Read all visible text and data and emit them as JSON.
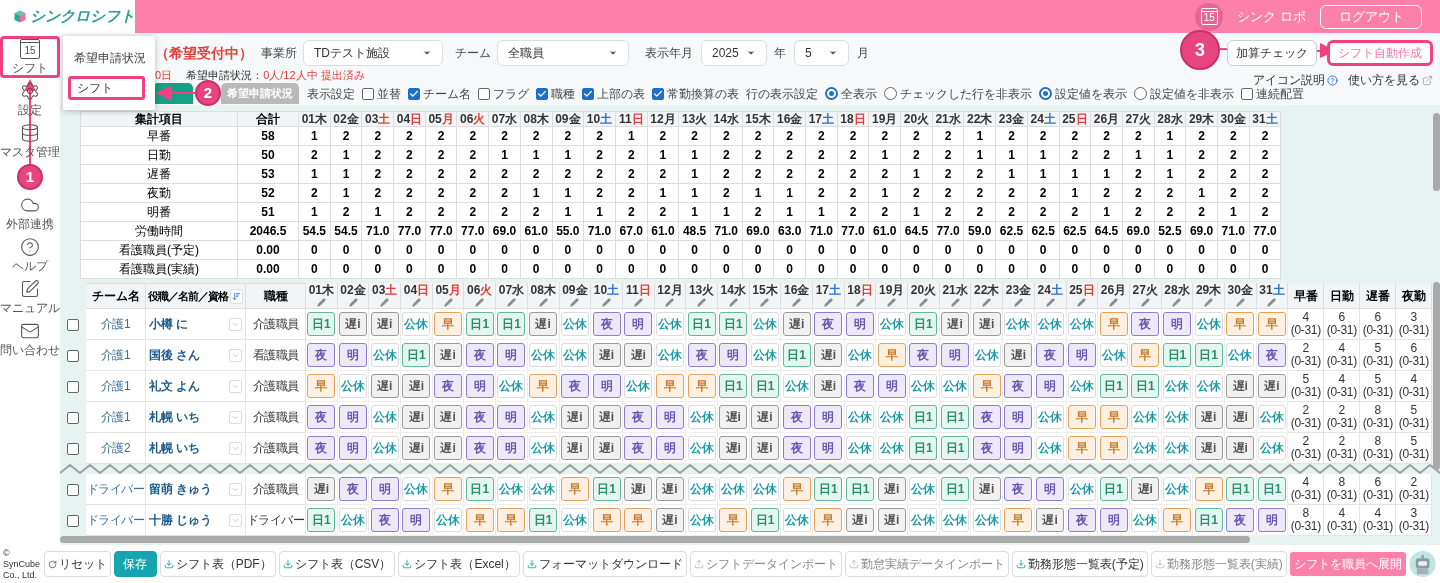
{
  "header": {
    "logo": "シンクロシフト",
    "calendar_date": "15",
    "robot_link": "シンク ロボ",
    "logout": "ログアウト"
  },
  "sidebar": {
    "items": [
      {
        "label": "シフト",
        "date": "15",
        "kind": "shift",
        "highlighted": true
      },
      {
        "label": "設定",
        "kind": "settings",
        "highlighted": false
      },
      {
        "label": "マスタ管理",
        "kind": "master",
        "highlighted": false
      },
      {
        "label": "外部連携",
        "kind": "integration",
        "highlighted": false
      },
      {
        "label": "ヘルプ",
        "kind": "help",
        "highlighted": false
      },
      {
        "label": "マニュアル",
        "kind": "manual",
        "highlighted": false
      },
      {
        "label": "問い合わせ",
        "kind": "contact",
        "highlighted": false
      }
    ]
  },
  "popup_menu": {
    "items": [
      {
        "label": "希望申請状況",
        "highlighted": false
      },
      {
        "label": "シフト",
        "highlighted": true
      }
    ]
  },
  "annotations": [
    {
      "label": "1"
    },
    {
      "label": "2"
    },
    {
      "label": "3"
    }
  ],
  "status": {
    "title": "（希望受付中）",
    "deadline": "0日",
    "request_label": "希望申請状況：",
    "request_value": "0人/12人中 提出済み"
  },
  "tabs": [
    {
      "selected": true
    },
    {
      "label": "希望申請状況",
      "selected": false
    }
  ],
  "filters": {
    "office_label": "事業所",
    "office": "TDテスト施設",
    "team_label": "チーム",
    "team": "全職員",
    "period_label": "表示年月",
    "year": "2025",
    "year_unit": "年",
    "month": "5",
    "month_unit": "月"
  },
  "actions": [
    {
      "label": "加算チェック",
      "highlighted": false
    },
    {
      "label": "シフト自動作成",
      "highlighted": true
    }
  ],
  "display_settings": {
    "label": "表示設定",
    "checkboxes": [
      {
        "label": "並替",
        "checked": false
      },
      {
        "label": "チーム名",
        "checked": true
      },
      {
        "label": "フラグ",
        "checked": false
      },
      {
        "label": "職種",
        "checked": true
      },
      {
        "label": "上部の表",
        "checked": true
      },
      {
        "label": "常勤換算の表",
        "checked": true
      }
    ],
    "row_label": "行の表示設定",
    "row_radios": [
      {
        "label": "全表示",
        "selected": true
      },
      {
        "label": "チェックした行を非表示",
        "selected": false
      }
    ],
    "value_radios": [
      {
        "label": "設定値を表示",
        "selected": true
      },
      {
        "label": "設定値を非表示",
        "selected": false
      }
    ],
    "continuous": {
      "label": "連続配置",
      "checked": false
    }
  },
  "links": [
    {
      "label": "アイコン説明",
      "kind": "help"
    },
    {
      "label": "使い方を見る",
      "kind": "external"
    }
  ],
  "summary": {
    "header": "集計項目",
    "total_header": "合計",
    "days": [
      {
        "date": "01",
        "weekday": "木",
        "kind": "weekday"
      },
      {
        "date": "02",
        "weekday": "金",
        "kind": "weekday"
      },
      {
        "date": "03",
        "weekday": "土",
        "kind": "holiday"
      },
      {
        "date": "04",
        "weekday": "日",
        "kind": "holiday"
      },
      {
        "date": "05",
        "weekday": "月",
        "kind": "holiday"
      },
      {
        "date": "06",
        "weekday": "火",
        "kind": "holiday"
      },
      {
        "date": "07",
        "weekday": "水",
        "kind": "weekday"
      },
      {
        "date": "08",
        "weekday": "木",
        "kind": "weekday"
      },
      {
        "date": "09",
        "weekday": "金",
        "kind": "weekday"
      },
      {
        "date": "10",
        "weekday": "土",
        "kind": "saturday"
      },
      {
        "date": "11",
        "weekday": "日",
        "kind": "holiday"
      },
      {
        "date": "12",
        "weekday": "月",
        "kind": "weekday"
      },
      {
        "date": "13",
        "weekday": "火",
        "kind": "weekday"
      },
      {
        "date": "14",
        "weekday": "水",
        "kind": "weekday"
      },
      {
        "date": "15",
        "weekday": "木",
        "kind": "weekday"
      },
      {
        "date": "16",
        "weekday": "金",
        "kind": "weekday"
      },
      {
        "date": "17",
        "weekday": "土",
        "kind": "saturday"
      },
      {
        "date": "18",
        "weekday": "日",
        "kind": "holiday"
      },
      {
        "date": "19",
        "weekday": "月",
        "kind": "weekday"
      },
      {
        "date": "20",
        "weekday": "火",
        "kind": "weekday"
      },
      {
        "date": "21",
        "weekday": "水",
        "kind": "weekday"
      },
      {
        "date": "22",
        "weekday": "木",
        "kind": "weekday"
      },
      {
        "date": "23",
        "weekday": "金",
        "kind": "weekday"
      },
      {
        "date": "24",
        "weekday": "土",
        "kind": "saturday"
      },
      {
        "date": "25",
        "weekday": "日",
        "kind": "holiday"
      },
      {
        "date": "26",
        "weekday": "月",
        "kind": "weekday"
      },
      {
        "date": "27",
        "weekday": "火",
        "kind": "weekday"
      },
      {
        "date": "28",
        "weekday": "水",
        "kind": "weekday"
      },
      {
        "date": "29",
        "weekday": "木",
        "kind": "weekday"
      },
      {
        "date": "30",
        "weekday": "金",
        "kind": "weekday"
      },
      {
        "date": "31",
        "weekday": "土",
        "kind": "saturday"
      }
    ],
    "rows": [
      {
        "label": "早番",
        "total": "58",
        "values": [
          "1",
          "2",
          "2",
          "2",
          "2",
          "2",
          "2",
          "2",
          "2",
          "2",
          "1",
          "2",
          "2",
          "2",
          "2",
          "2",
          "2",
          "2",
          "2",
          "2",
          "2",
          "1",
          "2",
          "2",
          "2",
          "2",
          "2",
          "1",
          "2",
          "2",
          "2"
        ]
      },
      {
        "label": "日勤",
        "total": "50",
        "values": [
          "2",
          "1",
          "2",
          "2",
          "2",
          "2",
          "1",
          "1",
          "1",
          "2",
          "2",
          "1",
          "1",
          "2",
          "2",
          "2",
          "2",
          "2",
          "1",
          "2",
          "2",
          "1",
          "1",
          "1",
          "2",
          "2",
          "1",
          "1",
          "2",
          "2",
          "2"
        ]
      },
      {
        "label": "遅番",
        "total": "53",
        "values": [
          "1",
          "1",
          "2",
          "2",
          "2",
          "2",
          "2",
          "2",
          "2",
          "2",
          "2",
          "2",
          "1",
          "2",
          "2",
          "2",
          "2",
          "2",
          "2",
          "1",
          "2",
          "2",
          "1",
          "1",
          "1",
          "1",
          "2",
          "1",
          "2",
          "2",
          "2"
        ]
      },
      {
        "label": "夜勤",
        "total": "52",
        "values": [
          "2",
          "1",
          "2",
          "2",
          "2",
          "2",
          "2",
          "1",
          "1",
          "2",
          "2",
          "1",
          "1",
          "2",
          "1",
          "1",
          "2",
          "2",
          "1",
          "2",
          "2",
          "2",
          "2",
          "2",
          "1",
          "2",
          "2",
          "2",
          "1",
          "2",
          "2"
        ]
      },
      {
        "label": "明番",
        "total": "51",
        "values": [
          "1",
          "2",
          "1",
          "2",
          "2",
          "2",
          "2",
          "2",
          "1",
          "1",
          "2",
          "2",
          "1",
          "1",
          "2",
          "1",
          "1",
          "2",
          "2",
          "1",
          "2",
          "2",
          "2",
          "2",
          "2",
          "1",
          "2",
          "2",
          "2",
          "1",
          "2"
        ]
      },
      {
        "label": "労働時間",
        "total": "2046.5",
        "values": [
          "54.5",
          "54.5",
          "71.0",
          "77.0",
          "77.0",
          "77.0",
          "69.0",
          "61.0",
          "55.0",
          "71.0",
          "67.0",
          "61.0",
          "48.5",
          "71.0",
          "69.0",
          "63.0",
          "71.0",
          "77.0",
          "61.0",
          "64.5",
          "77.0",
          "59.0",
          "62.5",
          "62.5",
          "62.5",
          "64.5",
          "69.0",
          "52.5",
          "69.0",
          "71.0",
          "77.0"
        ]
      },
      {
        "label": "看護職員(予定)",
        "total": "0.00",
        "values": [
          "0",
          "0",
          "0",
          "0",
          "0",
          "0",
          "0",
          "0",
          "0",
          "0",
          "0",
          "0",
          "0",
          "0",
          "0",
          "0",
          "0",
          "0",
          "0",
          "0",
          "0",
          "0",
          "0",
          "0",
          "0",
          "0",
          "0",
          "0",
          "0",
          "0",
          "0"
        ]
      },
      {
        "label": "看護職員(実績)",
        "total": "0.00",
        "values": [
          "0",
          "0",
          "0",
          "0",
          "0",
          "0",
          "0",
          "0",
          "0",
          "0",
          "0",
          "0",
          "0",
          "0",
          "0",
          "0",
          "0",
          "0",
          "0",
          "0",
          "0",
          "0",
          "0",
          "0",
          "0",
          "0",
          "0",
          "0",
          "0",
          "0",
          "0"
        ]
      }
    ]
  },
  "shift_table": {
    "columns": {
      "team": "チーム名",
      "name": "役職／名前／資格",
      "job": "職種"
    },
    "days": [
      {
        "date": "01",
        "weekday": "木",
        "kind": "weekday"
      },
      {
        "date": "02",
        "weekday": "金",
        "kind": "weekday"
      },
      {
        "date": "03",
        "weekday": "土",
        "kind": "holiday"
      },
      {
        "date": "04",
        "weekday": "日",
        "kind": "holiday"
      },
      {
        "date": "05",
        "weekday": "月",
        "kind": "holiday"
      },
      {
        "date": "06",
        "weekday": "火",
        "kind": "holiday"
      },
      {
        "date": "07",
        "weekday": "水",
        "kind": "weekday"
      },
      {
        "date": "08",
        "weekday": "木",
        "kind": "weekday"
      },
      {
        "date": "09",
        "weekday": "金",
        "kind": "weekday"
      },
      {
        "date": "10",
        "weekday": "土",
        "kind": "saturday"
      },
      {
        "date": "11",
        "weekday": "日",
        "kind": "holiday"
      },
      {
        "date": "12",
        "weekday": "月",
        "kind": "weekday"
      },
      {
        "date": "13",
        "weekday": "火",
        "kind": "weekday"
      },
      {
        "date": "14",
        "weekday": "水",
        "kind": "weekday"
      },
      {
        "date": "15",
        "weekday": "木",
        "kind": "weekday"
      },
      {
        "date": "16",
        "weekday": "金",
        "kind": "weekday"
      },
      {
        "date": "17",
        "weekday": "土",
        "kind": "saturday"
      },
      {
        "date": "18",
        "weekday": "日",
        "kind": "holiday"
      },
      {
        "date": "19",
        "weekday": "月",
        "kind": "weekday"
      },
      {
        "date": "20",
        "weekday": "火",
        "kind": "weekday"
      },
      {
        "date": "21",
        "weekday": "水",
        "kind": "weekday"
      },
      {
        "date": "22",
        "weekday": "木",
        "kind": "weekday"
      },
      {
        "date": "23",
        "weekday": "金",
        "kind": "weekday"
      },
      {
        "date": "24",
        "weekday": "土",
        "kind": "saturday"
      },
      {
        "date": "25",
        "weekday": "日",
        "kind": "holiday"
      },
      {
        "date": "26",
        "weekday": "月",
        "kind": "weekday"
      },
      {
        "date": "27",
        "weekday": "火",
        "kind": "weekday"
      },
      {
        "date": "28",
        "weekday": "水",
        "kind": "weekday"
      },
      {
        "date": "29",
        "weekday": "木",
        "kind": "weekday"
      },
      {
        "date": "30",
        "weekday": "金",
        "kind": "weekday"
      },
      {
        "date": "31",
        "weekday": "土",
        "kind": "saturday"
      }
    ],
    "count_columns": [
      "早番",
      "日勤",
      "遅番",
      "夜勤"
    ],
    "rows": [
      {
        "checked": false,
        "team": "介護1",
        "name": "小樽 に",
        "job": "介護職員",
        "shifts": [
          {
            "label": "日1",
            "kind": "day"
          },
          {
            "label": "遅i",
            "kind": "late"
          },
          {
            "label": "遅i",
            "kind": "late"
          },
          {
            "label": "公休",
            "kind": "off"
          },
          {
            "label": "早",
            "kind": "early"
          },
          {
            "label": "日1",
            "kind": "day"
          },
          {
            "label": "日1",
            "kind": "day"
          },
          {
            "label": "遅i",
            "kind": "late"
          },
          {
            "label": "公休",
            "kind": "off"
          },
          {
            "label": "夜",
            "kind": "night"
          },
          {
            "label": "明",
            "kind": "after"
          },
          {
            "label": "公休",
            "kind": "off"
          },
          {
            "label": "日1",
            "kind": "day"
          },
          {
            "label": "日1",
            "kind": "day"
          },
          {
            "label": "公休",
            "kind": "off"
          },
          {
            "label": "遅i",
            "kind": "late"
          },
          {
            "label": "夜",
            "kind": "night"
          },
          {
            "label": "明",
            "kind": "after"
          },
          {
            "label": "公休",
            "kind": "off"
          },
          {
            "label": "日1",
            "kind": "day"
          },
          {
            "label": "遅i",
            "kind": "late"
          },
          {
            "label": "遅i",
            "kind": "late"
          },
          {
            "label": "公休",
            "kind": "off"
          },
          {
            "label": "公休",
            "kind": "off"
          },
          {
            "label": "公休",
            "kind": "off"
          },
          {
            "label": "早",
            "kind": "early"
          },
          {
            "label": "夜",
            "kind": "night"
          },
          {
            "label": "明",
            "kind": "after"
          },
          {
            "label": "公休",
            "kind": "off"
          },
          {
            "label": "早",
            "kind": "early"
          },
          {
            "label": "早",
            "kind": "early"
          }
        ],
        "counts": [
          {
            "value": "4",
            "range": "(0-31)"
          },
          {
            "value": "6",
            "range": "(0-31)"
          },
          {
            "value": "6",
            "range": "(0-31)"
          },
          {
            "value": "3",
            "range": "(0-31)"
          }
        ]
      },
      {
        "checked": false,
        "team": "介護1",
        "name": "国後 さん",
        "job": "看護職員",
        "shifts": [
          {
            "label": "夜",
            "kind": "night"
          },
          {
            "label": "明",
            "kind": "after"
          },
          {
            "label": "公休",
            "kind": "off"
          },
          {
            "label": "日1",
            "kind": "day"
          },
          {
            "label": "遅i",
            "kind": "late"
          },
          {
            "label": "夜",
            "kind": "night"
          },
          {
            "label": "明",
            "kind": "after"
          },
          {
            "label": "公休",
            "kind": "off"
          },
          {
            "label": "公休",
            "kind": "off"
          },
          {
            "label": "遅i",
            "kind": "late"
          },
          {
            "label": "遅i",
            "kind": "late"
          },
          {
            "label": "公休",
            "kind": "off"
          },
          {
            "label": "夜",
            "kind": "night"
          },
          {
            "label": "明",
            "kind": "after"
          },
          {
            "label": "公休",
            "kind": "off"
          },
          {
            "label": "日1",
            "kind": "day"
          },
          {
            "label": "遅i",
            "kind": "late"
          },
          {
            "label": "公休",
            "kind": "off"
          },
          {
            "label": "早",
            "kind": "early"
          },
          {
            "label": "夜",
            "kind": "night"
          },
          {
            "label": "明",
            "kind": "after"
          },
          {
            "label": "公休",
            "kind": "off"
          },
          {
            "label": "遅i",
            "kind": "late"
          },
          {
            "label": "夜",
            "kind": "night"
          },
          {
            "label": "明",
            "kind": "after"
          },
          {
            "label": "公休",
            "kind": "off"
          },
          {
            "label": "早",
            "kind": "early"
          },
          {
            "label": "日1",
            "kind": "day"
          },
          {
            "label": "日1",
            "kind": "day"
          },
          {
            "label": "公休",
            "kind": "off"
          },
          {
            "label": "夜",
            "kind": "night"
          }
        ],
        "counts": [
          {
            "value": "2",
            "range": "(0-31)"
          },
          {
            "value": "4",
            "range": "(0-31)"
          },
          {
            "value": "5",
            "range": "(0-31)"
          },
          {
            "value": "6",
            "range": "(0-31)"
          }
        ]
      },
      {
        "checked": false,
        "team": "介護1",
        "name": "礼文 よん",
        "job": "介護職員",
        "shifts": [
          {
            "label": "早",
            "kind": "early"
          },
          {
            "label": "公休",
            "kind": "off"
          },
          {
            "label": "遅i",
            "kind": "late"
          },
          {
            "label": "遅i",
            "kind": "late"
          },
          {
            "label": "夜",
            "kind": "night"
          },
          {
            "label": "明",
            "kind": "after"
          },
          {
            "label": "公休",
            "kind": "off"
          },
          {
            "label": "早",
            "kind": "early"
          },
          {
            "label": "夜",
            "kind": "night"
          },
          {
            "label": "明",
            "kind": "after"
          },
          {
            "label": "公休",
            "kind": "off"
          },
          {
            "label": "早",
            "kind": "early"
          },
          {
            "label": "早",
            "kind": "early"
          },
          {
            "label": "日1",
            "kind": "day"
          },
          {
            "label": "日1",
            "kind": "day"
          },
          {
            "label": "公休",
            "kind": "off"
          },
          {
            "label": "遅i",
            "kind": "late"
          },
          {
            "label": "夜",
            "kind": "night"
          },
          {
            "label": "明",
            "kind": "after"
          },
          {
            "label": "公休",
            "kind": "off"
          },
          {
            "label": "公休",
            "kind": "off"
          },
          {
            "label": "早",
            "kind": "early"
          },
          {
            "label": "夜",
            "kind": "night"
          },
          {
            "label": "明",
            "kind": "after"
          },
          {
            "label": "公休",
            "kind": "off"
          },
          {
            "label": "日1",
            "kind": "day"
          },
          {
            "label": "日1",
            "kind": "day"
          },
          {
            "label": "公休",
            "kind": "off"
          },
          {
            "label": "公休",
            "kind": "off"
          },
          {
            "label": "遅i",
            "kind": "late"
          },
          {
            "label": "遅i",
            "kind": "late"
          }
        ],
        "counts": [
          {
            "value": "5",
            "range": "(0-31)"
          },
          {
            "value": "4",
            "range": "(0-31)"
          },
          {
            "value": "5",
            "range": "(0-31)"
          },
          {
            "value": "4",
            "range": "(0-31)"
          }
        ]
      },
      {
        "checked": false,
        "team": "介護1",
        "name": "札幌 いち",
        "job": "介護職員",
        "shifts": [
          {
            "label": "夜",
            "kind": "night"
          },
          {
            "label": "明",
            "kind": "after"
          },
          {
            "label": "公休",
            "kind": "off"
          },
          {
            "label": "遅i",
            "kind": "late"
          },
          {
            "label": "遅i",
            "kind": "late"
          },
          {
            "label": "夜",
            "kind": "night"
          },
          {
            "label": "明",
            "kind": "after"
          },
          {
            "label": "公休",
            "kind": "off"
          },
          {
            "label": "遅i",
            "kind": "late"
          },
          {
            "label": "遅i",
            "kind": "late"
          },
          {
            "label": "夜",
            "kind": "night"
          },
          {
            "label": "明",
            "kind": "after"
          },
          {
            "label": "公休",
            "kind": "off"
          },
          {
            "label": "遅i",
            "kind": "late"
          },
          {
            "label": "遅i",
            "kind": "late"
          },
          {
            "label": "夜",
            "kind": "night"
          },
          {
            "label": "明",
            "kind": "after"
          },
          {
            "label": "公休",
            "kind": "off"
          },
          {
            "label": "公休",
            "kind": "off"
          },
          {
            "label": "日1",
            "kind": "day"
          },
          {
            "label": "日1",
            "kind": "day"
          },
          {
            "label": "夜",
            "kind": "night"
          },
          {
            "label": "明",
            "kind": "after"
          },
          {
            "label": "公休",
            "kind": "off"
          },
          {
            "label": "早",
            "kind": "early"
          },
          {
            "label": "早",
            "kind": "early"
          },
          {
            "label": "公休",
            "kind": "off"
          },
          {
            "label": "公休",
            "kind": "off"
          },
          {
            "label": "遅i",
            "kind": "late"
          },
          {
            "label": "遅i",
            "kind": "late"
          },
          {
            "label": "公休",
            "kind": "off"
          }
        ],
        "counts": [
          {
            "value": "2",
            "range": "(0-31)"
          },
          {
            "value": "2",
            "range": "(0-31)"
          },
          {
            "value": "8",
            "range": "(0-31)"
          },
          {
            "value": "5",
            "range": "(0-31)"
          }
        ]
      },
      {
        "checked": false,
        "team": "介護2",
        "name": "札幌 いち",
        "job": "介護職員",
        "shifts": [
          {
            "label": "夜",
            "kind": "night"
          },
          {
            "label": "明",
            "kind": "after"
          },
          {
            "label": "公休",
            "kind": "off"
          },
          {
            "label": "遅i",
            "kind": "late"
          },
          {
            "label": "遅i",
            "kind": "late"
          },
          {
            "label": "夜",
            "kind": "night"
          },
          {
            "label": "明",
            "kind": "after"
          },
          {
            "label": "公休",
            "kind": "off"
          },
          {
            "label": "遅i",
            "kind": "late"
          },
          {
            "label": "遅i",
            "kind": "late"
          },
          {
            "label": "夜",
            "kind": "night"
          },
          {
            "label": "明",
            "kind": "after"
          },
          {
            "label": "公休",
            "kind": "off"
          },
          {
            "label": "遅i",
            "kind": "late"
          },
          {
            "label": "遅i",
            "kind": "late"
          },
          {
            "label": "夜",
            "kind": "night"
          },
          {
            "label": "明",
            "kind": "after"
          },
          {
            "label": "公休",
            "kind": "off"
          },
          {
            "label": "公休",
            "kind": "off"
          },
          {
            "label": "日1",
            "kind": "day"
          },
          {
            "label": "日1",
            "kind": "day"
          },
          {
            "label": "夜",
            "kind": "night"
          },
          {
            "label": "明",
            "kind": "after"
          },
          {
            "label": "公休",
            "kind": "off"
          },
          {
            "label": "早",
            "kind": "early"
          },
          {
            "label": "早",
            "kind": "early"
          },
          {
            "label": "公休",
            "kind": "off"
          },
          {
            "label": "公休",
            "kind": "off"
          },
          {
            "label": "遅i",
            "kind": "late"
          },
          {
            "label": "遅i",
            "kind": "late"
          },
          {
            "label": "公休",
            "kind": "off"
          }
        ],
        "counts": [
          {
            "value": "2",
            "range": "(0-31)"
          },
          {
            "value": "2",
            "range": "(0-31)"
          },
          {
            "value": "8",
            "range": "(0-31)"
          },
          {
            "value": "5",
            "range": "(0-31)"
          }
        ]
      }
    ],
    "rows_after_break": [
      {
        "checked": false,
        "team": "ドライバー",
        "name": "留萌 きゅう",
        "job": "介護職員",
        "shifts": [
          {
            "label": "遅i",
            "kind": "late"
          },
          {
            "label": "夜",
            "kind": "night"
          },
          {
            "label": "明",
            "kind": "after"
          },
          {
            "label": "公休",
            "kind": "off"
          },
          {
            "label": "早",
            "kind": "early"
          },
          {
            "label": "日1",
            "kind": "day"
          },
          {
            "label": "公休",
            "kind": "off"
          },
          {
            "label": "公休",
            "kind": "off"
          },
          {
            "label": "早",
            "kind": "early"
          },
          {
            "label": "日1",
            "kind": "day"
          },
          {
            "label": "遅i",
            "kind": "late"
          },
          {
            "label": "遅i",
            "kind": "late"
          },
          {
            "label": "公休",
            "kind": "off"
          },
          {
            "label": "公休",
            "kind": "off"
          },
          {
            "label": "公休",
            "kind": "off"
          },
          {
            "label": "早",
            "kind": "early"
          },
          {
            "label": "日1",
            "kind": "day"
          },
          {
            "label": "日1",
            "kind": "day"
          },
          {
            "label": "遅i",
            "kind": "late"
          },
          {
            "label": "公休",
            "kind": "off"
          },
          {
            "label": "日1",
            "kind": "day"
          },
          {
            "label": "遅i",
            "kind": "late"
          },
          {
            "label": "夜",
            "kind": "night"
          },
          {
            "label": "明",
            "kind": "after"
          },
          {
            "label": "公休",
            "kind": "off"
          },
          {
            "label": "日1",
            "kind": "day"
          },
          {
            "label": "遅i",
            "kind": "late"
          },
          {
            "label": "公休",
            "kind": "off"
          },
          {
            "label": "早",
            "kind": "early"
          },
          {
            "label": "日1",
            "kind": "day"
          },
          {
            "label": "日1",
            "kind": "day"
          }
        ],
        "counts": [
          {
            "value": "4",
            "range": "(0-31)"
          },
          {
            "value": "8",
            "range": "(0-31)"
          },
          {
            "value": "6",
            "range": "(0-31)"
          },
          {
            "value": "2",
            "range": "(0-31)"
          }
        ]
      },
      {
        "checked": false,
        "team": "ドライバー",
        "name": "十勝 じゅう",
        "job": "ドライバー",
        "shifts": [
          {
            "label": "日1",
            "kind": "day"
          },
          {
            "label": "公休",
            "kind": "off"
          },
          {
            "label": "夜",
            "kind": "night"
          },
          {
            "label": "明",
            "kind": "after"
          },
          {
            "label": "公休",
            "kind": "off"
          },
          {
            "label": "早",
            "kind": "early"
          },
          {
            "label": "早",
            "kind": "early"
          },
          {
            "label": "日1",
            "kind": "day"
          },
          {
            "label": "公休",
            "kind": "off"
          },
          {
            "label": "早",
            "kind": "early"
          },
          {
            "label": "早",
            "kind": "early"
          },
          {
            "label": "遅i",
            "kind": "late"
          },
          {
            "label": "公休",
            "kind": "off"
          },
          {
            "label": "早",
            "kind": "early"
          },
          {
            "label": "日1",
            "kind": "day"
          },
          {
            "label": "公休",
            "kind": "off"
          },
          {
            "label": "早",
            "kind": "early"
          },
          {
            "label": "遅i",
            "kind": "late"
          },
          {
            "label": "遅i",
            "kind": "late"
          },
          {
            "label": "公休",
            "kind": "off"
          },
          {
            "label": "公休",
            "kind": "off"
          },
          {
            "label": "公休",
            "kind": "off"
          },
          {
            "label": "早",
            "kind": "early"
          },
          {
            "label": "遅i",
            "kind": "late"
          },
          {
            "label": "夜",
            "kind": "night"
          },
          {
            "label": "明",
            "kind": "after"
          },
          {
            "label": "公休",
            "kind": "off"
          },
          {
            "label": "早",
            "kind": "early"
          },
          {
            "label": "日1",
            "kind": "day"
          },
          {
            "label": "夜",
            "kind": "night"
          },
          {
            "label": "明",
            "kind": "after"
          }
        ],
        "counts": [
          {
            "value": "8",
            "range": "(0-31)"
          },
          {
            "value": "4",
            "range": "(0-31)"
          },
          {
            "value": "4",
            "range": "(0-31)"
          },
          {
            "value": "3",
            "range": "(0-31)"
          }
        ]
      }
    ]
  },
  "footer": {
    "copyright": "© SynCube Co., Ltd.",
    "buttons": [
      {
        "label": "リセット",
        "kind": "reset",
        "disabled": false
      },
      {
        "label": "保存",
        "kind": "primary",
        "disabled": false
      },
      {
        "label": "シフト表（PDF）",
        "kind": "download",
        "disabled": false
      },
      {
        "label": "シフト表（CSV）",
        "kind": "download",
        "disabled": false
      },
      {
        "label": "シフト表（Excel）",
        "kind": "download",
        "disabled": false
      },
      {
        "label": "フォーマットダウンロード",
        "kind": "download",
        "disabled": false
      },
      {
        "label": "シフトデータインポート",
        "kind": "import",
        "disabled": true
      },
      {
        "label": "勤怠実績データインポート",
        "kind": "import",
        "disabled": true
      },
      {
        "label": "勤務形態一覧表(予定)",
        "kind": "download",
        "disabled": false
      },
      {
        "label": "勤務形態一覧表(実績)",
        "kind": "download",
        "disabled": true
      }
    ],
    "publish": "シフトを職員へ展開"
  }
}
